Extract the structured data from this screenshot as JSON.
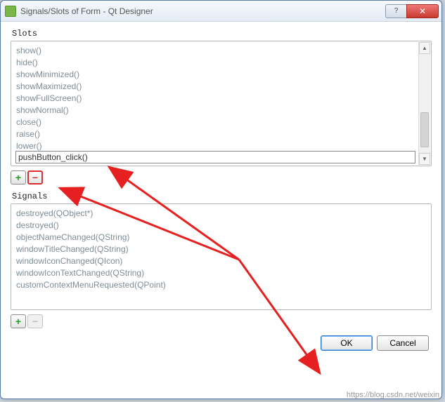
{
  "window": {
    "title": "Signals/Slots of Form - Qt Designer",
    "app_icon_label": "Qt",
    "help_glyph": "?",
    "close_glyph": "✕"
  },
  "slots": {
    "label": "Slots",
    "items": [
      "show()",
      "hide()",
      "showMinimized()",
      "showMaximized()",
      "showFullScreen()",
      "showNormal()",
      "close()",
      "raise()",
      "lower()"
    ],
    "editing_value": "pushButton_click()",
    "add_label": "+",
    "remove_label": "−"
  },
  "signals": {
    "label": "Signals",
    "items": [
      "destroyed(QObject*)",
      "destroyed()",
      "objectNameChanged(QString)",
      "windowTitleChanged(QString)",
      "windowIconChanged(QIcon)",
      "windowIconTextChanged(QString)",
      "customContextMenuRequested(QPoint)"
    ],
    "add_label": "+",
    "remove_label": "−"
  },
  "footer": {
    "ok_label": "OK",
    "cancel_label": "Cancel"
  },
  "watermark": "https://blog.csdn.net/weixin"
}
